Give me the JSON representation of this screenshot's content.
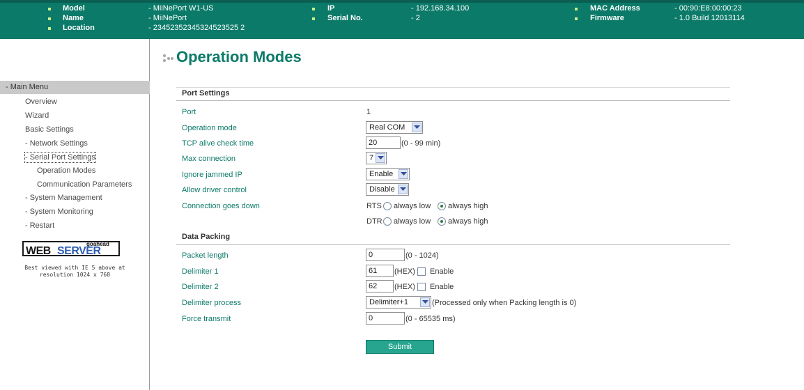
{
  "header": {
    "row1": {
      "label_a": "Model",
      "value_a": "- MiiNePort W1-US",
      "label_b": "IP",
      "value_b": "- 192.168.34.100",
      "label_c": "MAC Address",
      "value_c": "- 00:90:E8:00:00:23"
    },
    "row2": {
      "label_a": "Name",
      "value_a": "- MiiNePort",
      "label_b": "Serial No.",
      "value_b": "- 2",
      "label_c": "Firmware",
      "value_c": "- 1.0 Build 12013114"
    },
    "row3": {
      "label_a": "Location",
      "value_a": "- 23452352345324523525 2"
    }
  },
  "sidebar": {
    "menu_title": "- Main Menu",
    "items": [
      "Overview",
      "Wizard",
      "Basic Settings",
      "- Network Settings",
      "- Serial Port Settings",
      "Operation Modes",
      "Communication Parameters",
      "- System Management",
      "- System Monitoring",
      "- Restart"
    ],
    "logo_small": "goahead",
    "logo_web": "WEB",
    "logo_server": "SERVER",
    "logo_note_1": "Best viewed with IE 5 above at",
    "logo_note_2": "resolution 1024 x 768"
  },
  "page": {
    "title": "Operation Modes",
    "port_settings": {
      "section_title": "Port Settings",
      "port_label": "Port",
      "port_value": "1",
      "op_mode_label": "Operation mode",
      "op_mode_value": "Real COM",
      "tcp_alive_label": "TCP alive check time",
      "tcp_alive_value": "20",
      "tcp_alive_hint": "(0 - 99 min)",
      "max_conn_label": "Max connection",
      "max_conn_value": "7",
      "ignore_ip_label": "Ignore jammed IP",
      "ignore_ip_value": "Enable",
      "driver_ctrl_label": "Allow driver control",
      "driver_ctrl_value": "Disable",
      "conn_down_label": "Connection goes down",
      "rts_label": "RTS",
      "dtr_label": "DTR",
      "always_low": "always low",
      "always_high": "always high"
    },
    "data_packing": {
      "section_title": "Data Packing",
      "packet_len_label": "Packet length",
      "packet_len_value": "0",
      "packet_len_hint": "(0 - 1024)",
      "delim1_label": "Delimiter 1",
      "delim1_value": "61",
      "delim2_label": "Delimiter 2",
      "delim2_value": "62",
      "hex_label": "(HEX)",
      "enable_label": "Enable",
      "delim_proc_label": "Delimiter process",
      "delim_proc_value": "Delimiter+1",
      "delim_proc_hint": "(Processed only when Packing length is 0)",
      "force_tx_label": "Force transmit",
      "force_tx_value": "0",
      "force_tx_hint": "(0 - 65535 ms)"
    },
    "submit_label": "Submit"
  }
}
